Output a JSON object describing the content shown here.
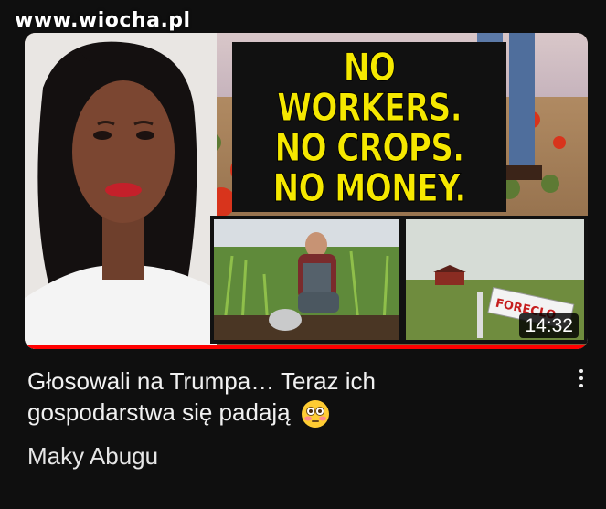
{
  "watermark": "www.wiocha.pl",
  "thumbnail": {
    "headline_lines": [
      "NO WORKERS.",
      "NO CROPS.",
      "NO MONEY."
    ],
    "sign_text": "FORECLO",
    "duration": "14:32",
    "progress": 1.0
  },
  "video": {
    "title_line1": "Głosowali na Trumpa… Teraz ich",
    "title_line2": "gospodarstwa się padają",
    "title_emoji": "flushed-face",
    "channel": "Maky Abugu"
  },
  "colors": {
    "headline_yellow": "#f5e800",
    "progress_red": "#ff0000",
    "background": "#0f0f0f"
  }
}
